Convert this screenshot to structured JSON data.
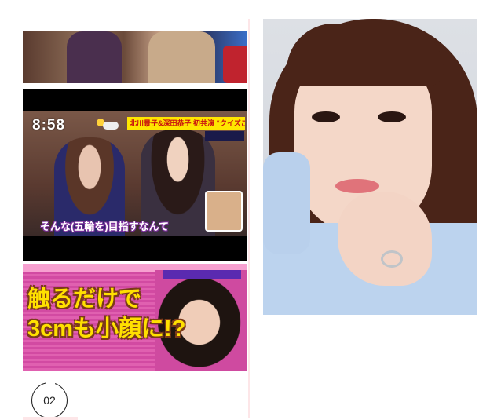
{
  "images": {
    "top": {
      "description_icon": "tv-still-icon"
    },
    "middle": {
      "clock": "8:58",
      "banner": "北川景子&深田恭子 初共演 “クイズご長寿”",
      "caption": "そんな(五輪を)目指すなんて"
    },
    "bottom": {
      "headline_line1": "触るだけで",
      "headline_line2": "3cmも小顔に!?"
    },
    "portrait": {
      "description_icon": "portrait-photo-icon"
    }
  },
  "page": {
    "number": "02"
  }
}
